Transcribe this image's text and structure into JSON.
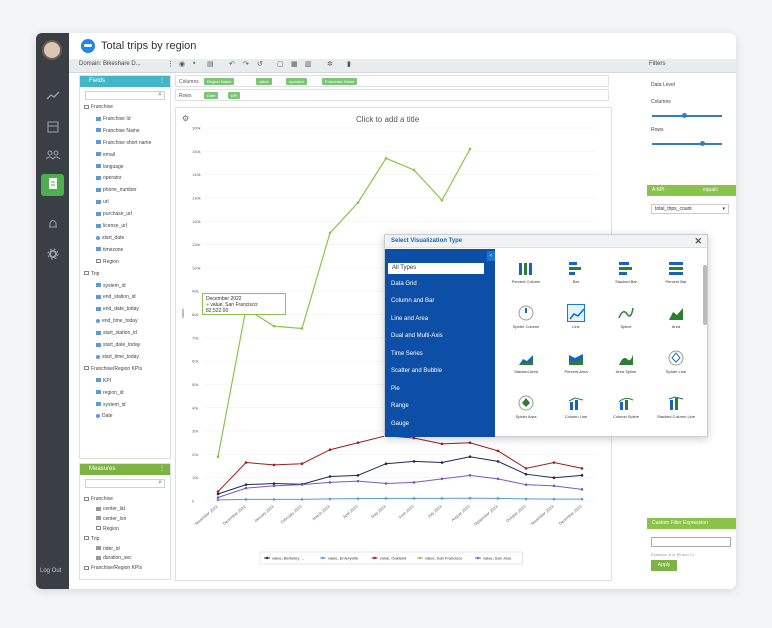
{
  "app": {
    "title": "Total trips by region",
    "logout": "Log Out"
  },
  "nav": [
    "avatar",
    "chart-icon",
    "dashboard-icon",
    "users-icon",
    "report-icon",
    "bell-icon",
    "gear-icon"
  ],
  "toolbar": {
    "domain": "Domain: Bikeshare D...",
    "filters": "Filters"
  },
  "fields": {
    "header": "Fields",
    "items": [
      {
        "label": "Franchise",
        "type": "folder",
        "indent": 0
      },
      {
        "label": "Franchise Id",
        "type": "text",
        "indent": 1
      },
      {
        "label": "Franchise Name",
        "type": "text",
        "indent": 1
      },
      {
        "label": "Franchise short name",
        "type": "text",
        "indent": 1
      },
      {
        "label": "email",
        "type": "text",
        "indent": 1
      },
      {
        "label": "language",
        "type": "text",
        "indent": 1
      },
      {
        "label": "operator",
        "type": "text",
        "indent": 1
      },
      {
        "label": "phone_number",
        "type": "text",
        "indent": 1
      },
      {
        "label": "url",
        "type": "text",
        "indent": 1
      },
      {
        "label": "purchase_url",
        "type": "text",
        "indent": 1
      },
      {
        "label": "license_url",
        "type": "text",
        "indent": 1
      },
      {
        "label": "start_date",
        "type": "time",
        "indent": 1
      },
      {
        "label": "timezone",
        "type": "text",
        "indent": 1
      },
      {
        "label": "Region",
        "type": "folder",
        "indent": 1
      },
      {
        "label": "Trip",
        "type": "folder",
        "indent": 0
      },
      {
        "label": "system_id",
        "type": "text",
        "indent": 1
      },
      {
        "label": "end_station_id",
        "type": "text",
        "indent": 1
      },
      {
        "label": "end_date_today",
        "type": "date",
        "indent": 1
      },
      {
        "label": "end_time_today",
        "type": "time",
        "indent": 1
      },
      {
        "label": "start_station_id",
        "type": "text",
        "indent": 1
      },
      {
        "label": "start_date_today",
        "type": "date",
        "indent": 1
      },
      {
        "label": "start_time_today",
        "type": "time",
        "indent": 1
      },
      {
        "label": "Franchise/Region KPIs",
        "type": "folder",
        "indent": 0
      },
      {
        "label": "KPI",
        "type": "text",
        "indent": 1
      },
      {
        "label": "region_id",
        "type": "text",
        "indent": 1
      },
      {
        "label": "system_id",
        "type": "text",
        "indent": 1
      },
      {
        "label": "Date",
        "type": "time",
        "indent": 1
      }
    ]
  },
  "measures": {
    "header": "Measures",
    "items": [
      {
        "label": "Franchise",
        "type": "folder",
        "indent": 0
      },
      {
        "label": "center_lat",
        "type": "num",
        "indent": 1
      },
      {
        "label": "center_lon",
        "type": "num",
        "indent": 1
      },
      {
        "label": "Region",
        "type": "folder",
        "indent": 1
      },
      {
        "label": "Trip",
        "type": "folder",
        "indent": 0
      },
      {
        "label": "rider_id",
        "type": "num",
        "indent": 1
      },
      {
        "label": "duration_sec",
        "type": "num",
        "indent": 1
      },
      {
        "label": "Franchise/Region KPIs",
        "type": "folder",
        "indent": 0
      }
    ]
  },
  "shelves": {
    "columns_label": "Columns",
    "rows_label": "Rows",
    "columns": [
      "Region Name",
      "value",
      "operator",
      "Franchise Name"
    ],
    "rows": [
      "Date",
      "KPI"
    ]
  },
  "chart": {
    "placeholder_title": "Click to add a title",
    "tooltip_date": "December 2022",
    "tooltip_value": "value, San Francisco: 82,522.00"
  },
  "chart_data": {
    "type": "line",
    "ylabel": "value",
    "ylim": [
      0,
      160000
    ],
    "yticks": [
      "0",
      "10k",
      "20k",
      "30k",
      "40k",
      "50k",
      "60k",
      "70k",
      "80k",
      "90k",
      "100k",
      "110k",
      "120k",
      "130k",
      "140k",
      "150k",
      "160k"
    ],
    "categories": [
      "November 2022",
      "December 2022",
      "January 2023",
      "February 2023",
      "March 2023",
      "April 2023",
      "May 2023",
      "June 2023",
      "July 2023",
      "August 2023",
      "September 2023",
      "October 2023",
      "November 2023",
      "December 2023"
    ],
    "series": [
      {
        "name": "value, Berkeley ...",
        "color": "#1f2a4d",
        "values": [
          3000,
          7000,
          7500,
          7200,
          10500,
          11000,
          16000,
          17000,
          16500,
          19000,
          17000,
          11500,
          10000,
          11000
        ]
      },
      {
        "name": "value, Emeryville",
        "color": "#5b9bd5",
        "values": [
          500,
          700,
          700,
          700,
          900,
          1000,
          1100,
          1100,
          1100,
          1200,
          1100,
          900,
          800,
          800
        ]
      },
      {
        "name": "value, Oakland",
        "color": "#a31a1a",
        "values": [
          4000,
          16500,
          15500,
          16000,
          22000,
          25000,
          28000,
          27000,
          24500,
          25000,
          21500,
          14000,
          16500,
          14000
        ]
      },
      {
        "name": "value, San Francisco",
        "color": "#8bc34a",
        "values": [
          19000,
          82522,
          75000,
          74000,
          115000,
          128000,
          147000,
          142000,
          129000,
          151000,
          null,
          null,
          null,
          null
        ]
      },
      {
        "name": "value, San Jose",
        "color": "#7e57c2",
        "values": [
          1500,
          5500,
          6500,
          7000,
          8000,
          8500,
          7500,
          8000,
          9500,
          11000,
          9500,
          7000,
          6500,
          5000
        ]
      }
    ]
  },
  "filters": {
    "header": "Filters",
    "data_level": "Data Level",
    "columns": "Columns",
    "rows": "Rows",
    "kpi_header": "A KPI",
    "kpi_op": "equals",
    "kpi_value": "total_trips_count",
    "custom_header": "Custom Filter Expression",
    "custom_hint": "Example: A or (B and C)",
    "apply": "Apply"
  },
  "viz": {
    "title": "Select Visualization Type",
    "categories": [
      "All Types",
      "Data Grid",
      "Column and Bar",
      "Line and Area",
      "Dual and Multi-Axis",
      "Time Series",
      "Scatter and Bubble",
      "Pie",
      "Range",
      "Gauge"
    ],
    "types": [
      "Percent Column",
      "Bar",
      "Stacked Bar",
      "Percent Bar",
      "Spider Column",
      "Line",
      "Spline",
      "Area",
      "Stacked Area",
      "Percent Area",
      "Area Spline",
      "Spider Line",
      "Spider Area",
      "Column Line",
      "Column Spline",
      "Stacked Column Line"
    ],
    "selected": "Line"
  }
}
